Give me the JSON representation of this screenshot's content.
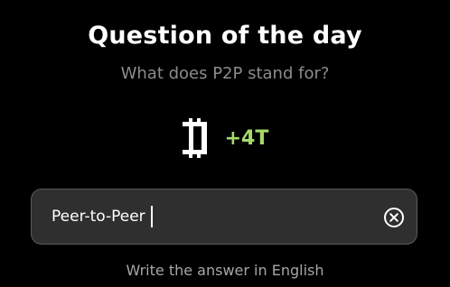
{
  "header": {
    "title": "Question of the day",
    "question": "What does P2P stand for?"
  },
  "reward": {
    "icon": "coin-icon",
    "amount": "+4T",
    "accent_color": "#a6d96a"
  },
  "answer": {
    "value": "Peer-to-Peer",
    "clear_icon": "close-circle-icon"
  },
  "hint": "Write the answer in English"
}
